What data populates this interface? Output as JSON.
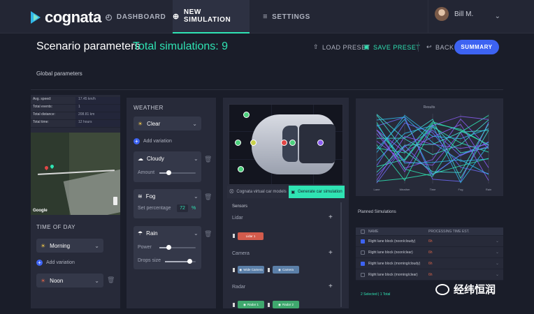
{
  "app": {
    "brand": "cognata"
  },
  "nav": {
    "tabs": [
      {
        "label": "DASHBOARD",
        "icon": "gauge-icon"
      },
      {
        "label": "NEW SIMULATION",
        "icon": "plus-circle-icon"
      },
      {
        "label": "SETTINGS",
        "icon": "sliders-icon"
      }
    ],
    "user": {
      "name": "Bill M."
    }
  },
  "header": {
    "title": "Scenario parameters",
    "total_simulations": "Total simulations: 9",
    "load_preset": "LOAD PRESET",
    "save_preset": "SAVE PRESET",
    "back": "BACK",
    "summary": "SUMMARY"
  },
  "global_parameters_label": "Global parameters",
  "stats": [
    {
      "key": "Avg. speed:",
      "value": "17.45 km/h"
    },
    {
      "key": "Total events:",
      "value": "1"
    },
    {
      "key": "Total distance:",
      "value": "208.81 km"
    },
    {
      "key": "Total time:",
      "value": "12 hours"
    }
  ],
  "map": {
    "attribution": "Google"
  },
  "time_of_day": {
    "title": "TIME OF DAY",
    "first": "Morning",
    "add_variation": "Add variation",
    "second": "Noon"
  },
  "weather": {
    "title": "WEATHER",
    "first": "Clear",
    "add_variation": "Add variation",
    "cloudy": {
      "label": "Cloudy",
      "amount_label": "Amount",
      "amount": 0.25
    },
    "fog": {
      "label": "Fog",
      "set_pct_label": "Set percentage",
      "pct_value": "72",
      "pct_unit": "%"
    },
    "rain": {
      "label": "Rain",
      "power_label": "Power",
      "power": 0.25,
      "drops_label": "Drops size",
      "drops": 0.8
    }
  },
  "sensor_panel": {
    "segment_left": "Cognata virtual car models",
    "segment_right": "Generate car simulation",
    "sensors_title": "Sensors",
    "lidar": {
      "title": "Lidar",
      "chips": [
        "Lidar 1"
      ]
    },
    "camera": {
      "title": "Camera",
      "chips": [
        "Wide Camera",
        "Camera"
      ]
    },
    "radar": {
      "title": "Radar",
      "chips": [
        "Radar 1",
        "Radar 2"
      ]
    }
  },
  "chart_data": {
    "type": "line",
    "title": "Results",
    "categories": [
      "Lane",
      "Weather",
      "Time",
      "Fog",
      "Rain"
    ],
    "colors": [
      "#2fe3b3",
      "#2fb6e9",
      "#8a5cf0",
      "#3fd9d0",
      "#6d6af5"
    ]
  },
  "planned": {
    "title": "Planned Simulations",
    "col_name": "NAME",
    "col_time": "PROCESSING TIME EST.",
    "rows": [
      {
        "name": "Right lane block (noon/cloudy)",
        "time": "6h",
        "checked": true
      },
      {
        "name": "Right lane block (noon/clear)",
        "time": "6h",
        "checked": false
      },
      {
        "name": "Right lane block (morning/cloudy)",
        "time": "6h",
        "checked": true
      },
      {
        "name": "Right lane block (morning/clear)",
        "time": "6h",
        "checked": false
      }
    ],
    "selected_info": "2 Selected | 1 Total"
  },
  "watermark": {
    "text": "经纬恒润"
  }
}
